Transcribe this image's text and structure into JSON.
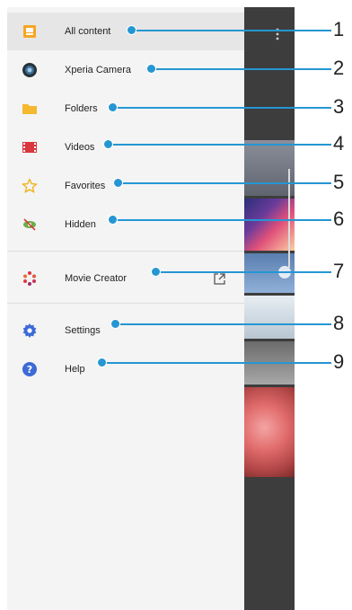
{
  "menu": {
    "items": [
      {
        "label": "All content",
        "icon": "all-content-icon"
      },
      {
        "label": "Xperia Camera",
        "icon": "camera-icon"
      },
      {
        "label": "Folders",
        "icon": "folder-icon"
      },
      {
        "label": "Videos",
        "icon": "film-icon"
      },
      {
        "label": "Favorites",
        "icon": "star-icon"
      },
      {
        "label": "Hidden",
        "icon": "hidden-eye-icon"
      },
      {
        "label": "Movie Creator",
        "icon": "movie-creator-icon"
      },
      {
        "label": "Settings",
        "icon": "gear-icon"
      },
      {
        "label": "Help",
        "icon": "help-icon"
      }
    ],
    "active_index": 0
  },
  "callouts": [
    "1",
    "2",
    "3",
    "4",
    "5",
    "6",
    "7",
    "8",
    "9"
  ],
  "colors": {
    "accent": "#2596d2",
    "orange": "#f5a623",
    "red": "#d9363e",
    "icon_blue": "#3d6ad6"
  }
}
